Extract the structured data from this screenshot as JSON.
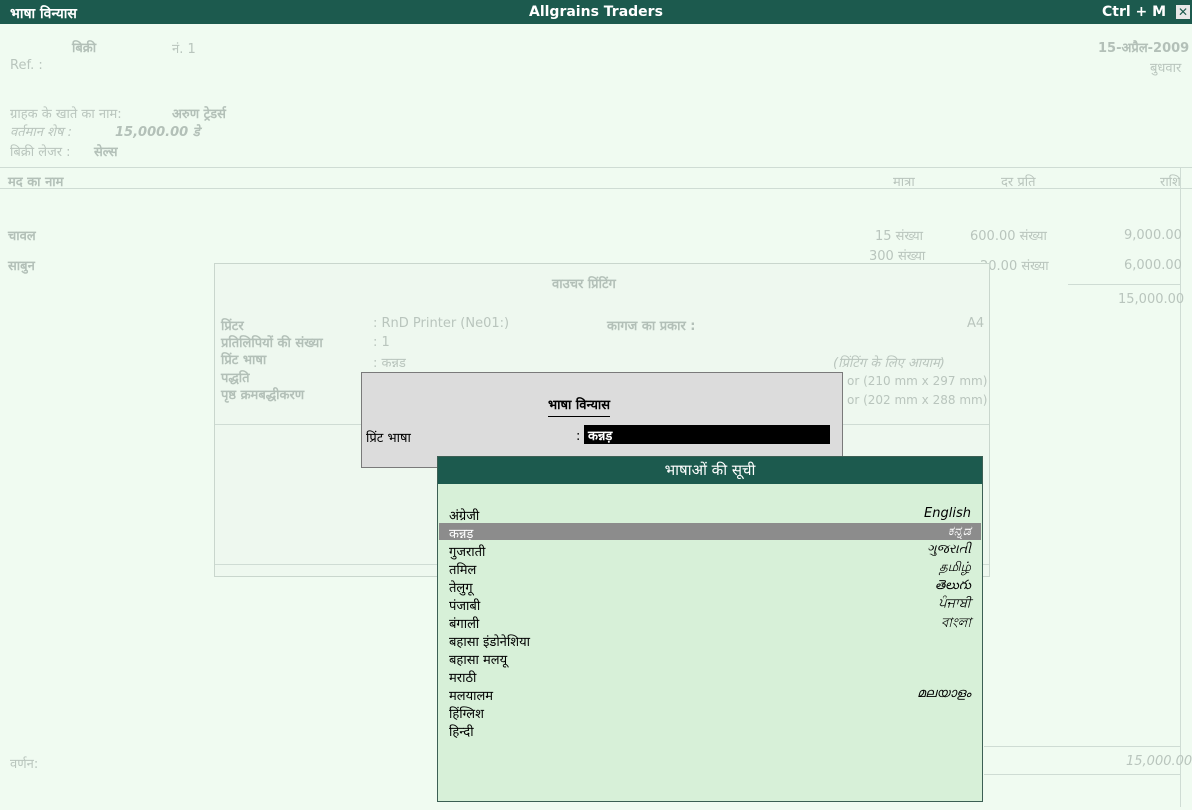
{
  "titlebar": {
    "left": "भाषा विन्यास",
    "center": "Allgrains Traders",
    "right": "Ctrl + M",
    "close": "✕"
  },
  "voucher": {
    "type": "बिक्री",
    "number_label": "नं. 1",
    "ref_label": "Ref. :",
    "date": "15-अप्रैल-2009",
    "day": "बुधवार",
    "party_label": "ग्राहक के खाते का नाम:",
    "party_value": "अरुण ट्रेडर्स",
    "balance_label": "वर्तमान शेष :",
    "balance_value": "15,000.00 डे",
    "ledger_label": "बिक्री लेजर :",
    "ledger_value": "सेल्स",
    "columns": {
      "item": "मद का नाम",
      "qty": "मात्रा",
      "rate": "दर प्रति",
      "amount": "राशि"
    },
    "rows": [
      {
        "item": "चावल",
        "qty": "15 संख्या",
        "rate": "600.00 संख्या",
        "amount": "9,000.00"
      },
      {
        "item": "साबुन",
        "qty": "300 संख्या",
        "rate": "20.00 संख्या",
        "amount": "6,000.00"
      }
    ],
    "total": "15,000.00",
    "narration_label": "वर्णन:",
    "grand_total": "15,000.00"
  },
  "voucher_printing": {
    "title": "वाउचर प्रिंटिंग",
    "printer_label": "प्रिंटर",
    "printer_value": ": RnD Printer (Ne01:)",
    "paper_label": "कागज का प्रकार :",
    "paper_value": "A4",
    "copies_label": "प्रतिलिपियों की संख्या",
    "copies_value": ": 1",
    "print_lang_label": "प्रिंट भाषा",
    "print_lang_value": ": कन्नड",
    "method_label": "पद्धति",
    "page_label": "पृष्ठ क्रमबद्धीकरण",
    "dimensions_label": "(प्रिंटिंग के लिए आयाम)",
    "dim1": "or (210 mm x 297 mm)",
    "dim2": "or (202 mm x 288 mm)"
  },
  "language_config": {
    "title": "भाषा विन्यास",
    "field_label": "प्रिंट भाषा",
    "field_value": "कन्नड़"
  },
  "language_list": {
    "title": "भाषाओं की सूची",
    "items": [
      {
        "label": "अंग्रेजी",
        "native": "English"
      },
      {
        "label": "कन्नड़",
        "native": "ಕನ್ನಡ"
      },
      {
        "label": "गुजराती",
        "native": "ગુજરાતી"
      },
      {
        "label": "तमिल",
        "native": "தமிழ்"
      },
      {
        "label": "तेलुगू",
        "native": "తెలుగు"
      },
      {
        "label": "पंजाबी",
        "native": "ਪੰਜਾਬੀ"
      },
      {
        "label": "बंगाली",
        "native": "বাংলা"
      },
      {
        "label": "बहासा इंडोनेशिया",
        "native": ""
      },
      {
        "label": "बहासा मलयू",
        "native": ""
      },
      {
        "label": "मराठी",
        "native": ""
      },
      {
        "label": "मलयालम",
        "native": "മലയാളം"
      },
      {
        "label": "हिंग्लिश",
        "native": ""
      },
      {
        "label": "हिन्दी",
        "native": ""
      }
    ],
    "selected_index": 1
  }
}
